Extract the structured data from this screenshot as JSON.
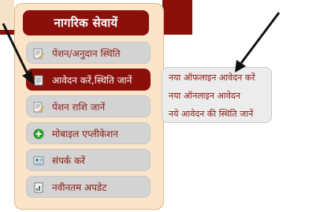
{
  "panel": {
    "title": "नागरिक सेवायें"
  },
  "menu": {
    "items": [
      {
        "label": "पेंशन/अनुदान स्थिति",
        "icon": "document-pencil-icon"
      },
      {
        "label": "आवेदन करें,स्थिति जानें",
        "icon": "document-icon",
        "active": true
      },
      {
        "label": "पेंशन राशि जानें",
        "icon": "document-pencil-icon"
      },
      {
        "label": "मोबाइल एप्लीकेशन",
        "icon": "green-plus-circle-icon"
      },
      {
        "label": "संपर्क करें",
        "icon": "contact-card-icon"
      },
      {
        "label": "नवीनतम अपडेट",
        "icon": "chart-document-icon"
      }
    ]
  },
  "submenu": {
    "items": [
      "नया ऑफलाइन आवेदन करें",
      "नया ऑनलाइन आवेदन",
      "नये आवेदन की स्थिति जानें"
    ]
  },
  "colors": {
    "accent": "#8b0f0b",
    "panel_bg": "#fbe4c8",
    "item_bg": "#d3d3d3",
    "item_text": "#8b1a10"
  }
}
